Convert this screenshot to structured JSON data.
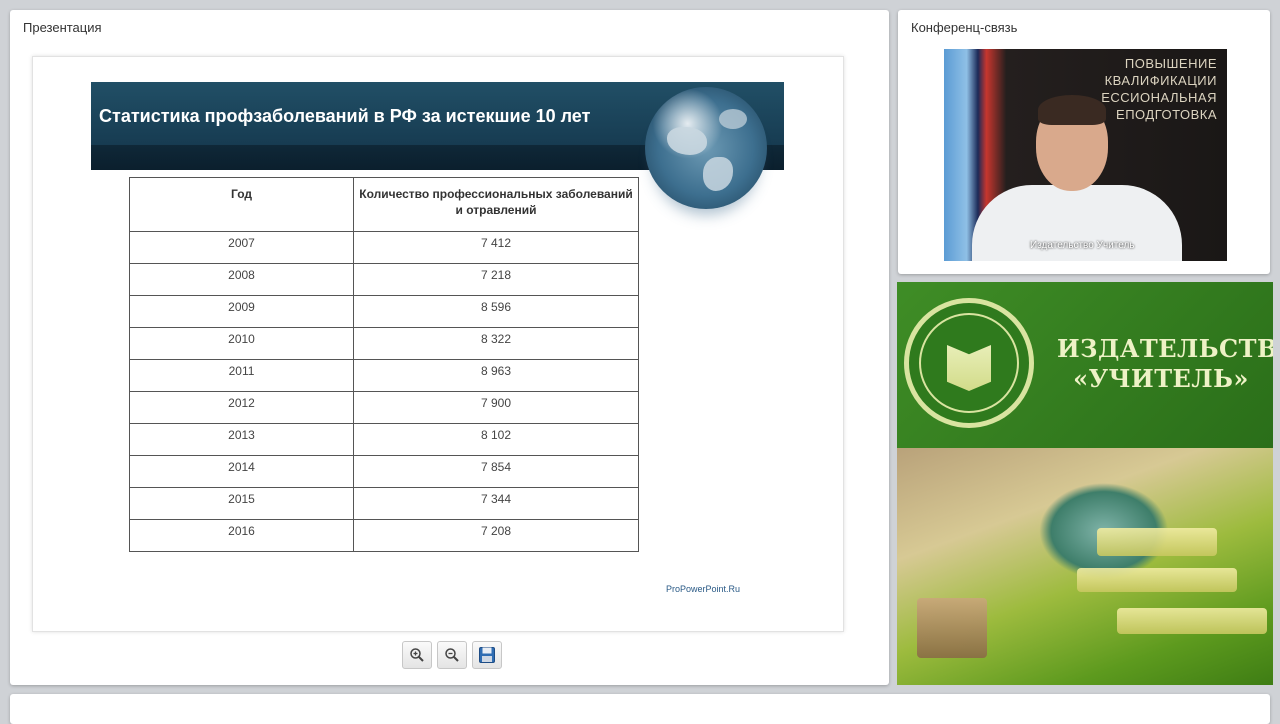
{
  "presentation": {
    "panel_title": "Презентация",
    "slide": {
      "title": "Статистика профзаболеваний в РФ за истекшие 10 лет",
      "table": {
        "headers": [
          "Год",
          "Количество профессиональных заболеваний и отравлений"
        ],
        "rows": [
          [
            "2007",
            "7 412"
          ],
          [
            "2008",
            "7 218"
          ],
          [
            "2009",
            "8 596"
          ],
          [
            "2010",
            "8 322"
          ],
          [
            "2011",
            "8 963"
          ],
          [
            "2012",
            "7 900"
          ],
          [
            "2013",
            "8 102"
          ],
          [
            "2014",
            "7 854"
          ],
          [
            "2015",
            "7 344"
          ],
          [
            "2016",
            "7 208"
          ]
        ]
      },
      "credit": "ProPowerPoint.Ru"
    },
    "toolbar": {
      "zoom_in_icon": "zoom-in-icon",
      "zoom_out_icon": "zoom-out-icon",
      "save_icon": "save-icon"
    }
  },
  "conference": {
    "panel_title": "Конференц-связь",
    "video_banner_lines": [
      "ПОВЫШЕНИЕ",
      "КВАЛИФИКАЦИИ",
      "ЕССИОНАЛЬНАЯ",
      "ЕПОДГОТОВКА"
    ],
    "caption": "Издательство Учитель"
  },
  "branding": {
    "line1": "ИЗДАТЕЛЬСТВО",
    "line2": "«УЧИТЕЛЬ»",
    "colors": {
      "green": "#2f7a1d",
      "cream": "#eef2c6"
    }
  }
}
